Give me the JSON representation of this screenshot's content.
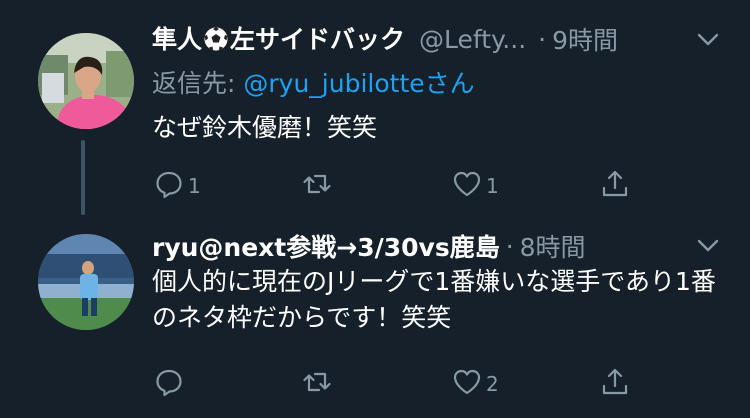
{
  "tweets": [
    {
      "display_name_before": "隼人",
      "display_name_after": "左サイドバック",
      "handle": "@Lefty...",
      "separator": "·",
      "time": "9時間",
      "reply_label": "返信先: ",
      "reply_mention": "@ryu_jubilotte",
      "reply_suffix": "さん",
      "text": "なぜ鈴木優磨！笑笑",
      "reply_count": "1",
      "retweet_count": "",
      "like_count": "1"
    },
    {
      "display_name": "ryu@next参戦→3/30vs鹿島",
      "separator": "·",
      "time": "8時間",
      "text": "個人的に現在のJリーグで1番嫌いな選手であり1番のネタ枠だからです！笑笑",
      "reply_count": "",
      "retweet_count": "",
      "like_count": "2"
    }
  ],
  "colors": {
    "background": "#15202b",
    "secondary_text": "#8899a6",
    "link": "#1da1f2",
    "thread_line": "#3d5466"
  },
  "icons": [
    "reply-icon",
    "retweet-icon",
    "like-icon",
    "share-icon",
    "chevron-down-icon",
    "soccer-ball-icon"
  ]
}
